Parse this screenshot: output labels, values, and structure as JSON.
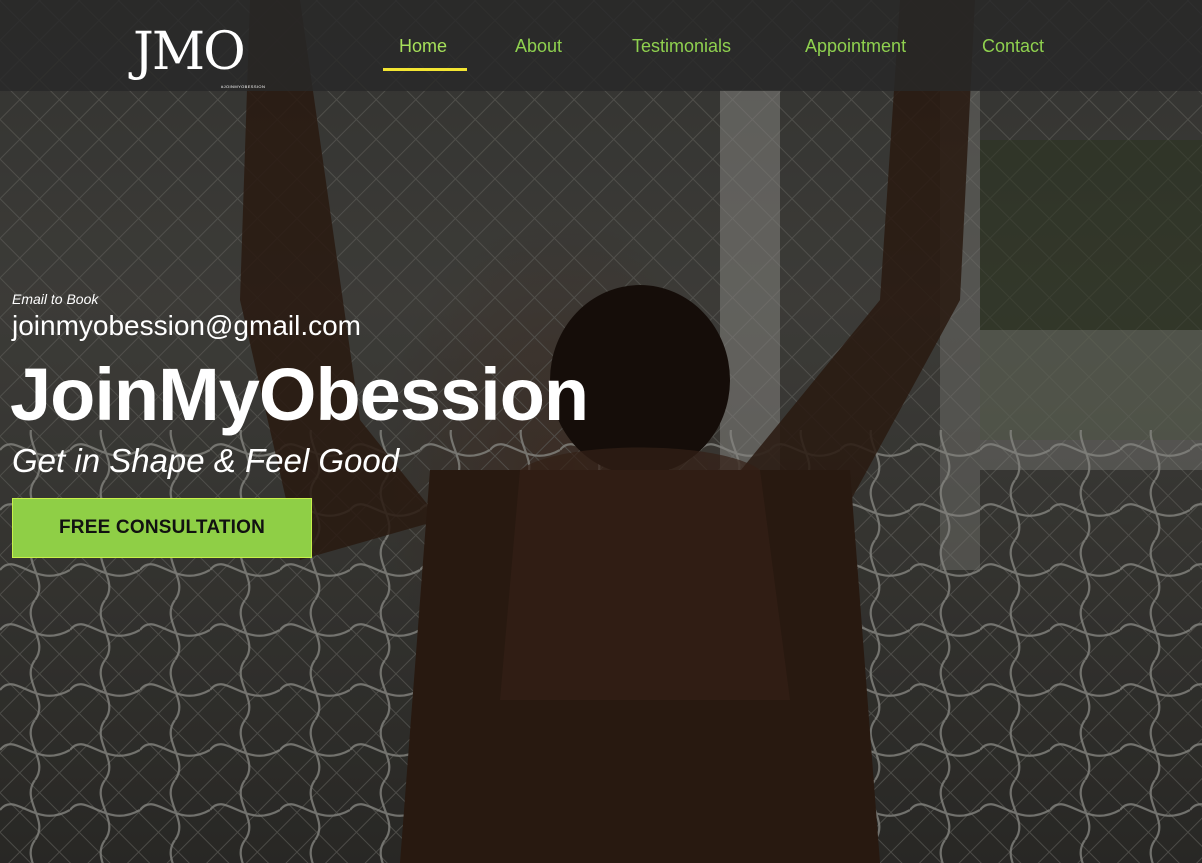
{
  "header": {
    "logo_text": "JMO",
    "logo_tagline": "#JOINMYOBESSION",
    "nav": [
      {
        "label": "Home",
        "active": true
      },
      {
        "label": "About",
        "active": false
      },
      {
        "label": "Testimonials",
        "active": false
      },
      {
        "label": "Appointment",
        "active": false
      },
      {
        "label": "Contact",
        "active": false
      }
    ]
  },
  "hero": {
    "email_label": "Email to Book",
    "email": "joinmyobession@gmail.com",
    "title": "JoinMyObession",
    "tagline": "Get in Shape & Feel Good",
    "cta_label": "FREE CONSULTATION"
  },
  "colors": {
    "accent_green": "#8fcf46",
    "nav_text": "#8fd14f",
    "active_underline": "#f3e532",
    "navbar_bg": "#282828"
  }
}
